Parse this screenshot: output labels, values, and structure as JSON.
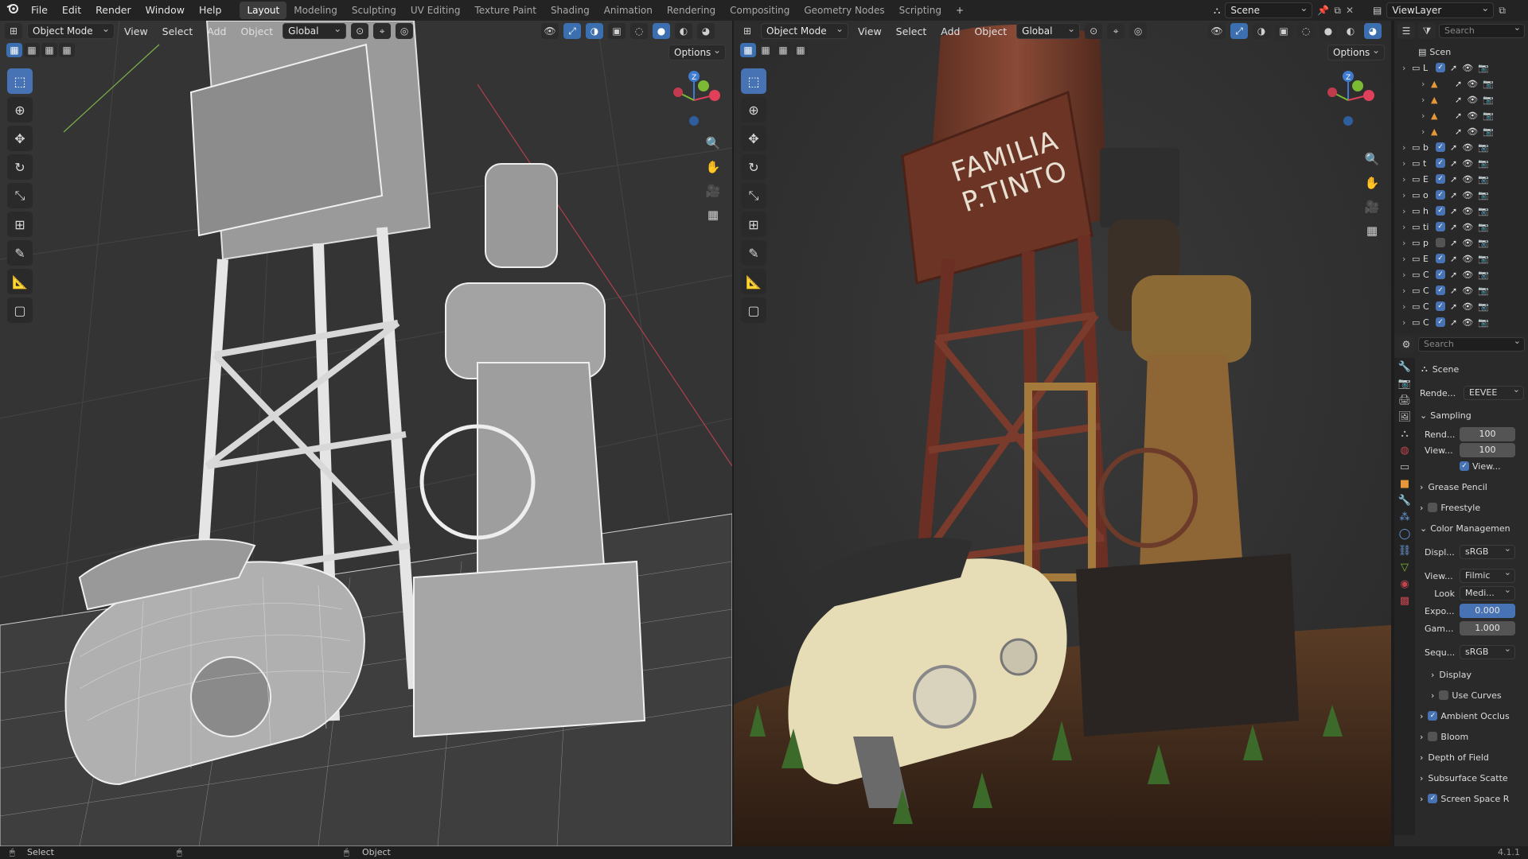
{
  "topbar": {
    "menus": [
      "File",
      "Edit",
      "Render",
      "Window",
      "Help"
    ],
    "workspaces": [
      "Layout",
      "Modeling",
      "Sculpting",
      "UV Editing",
      "Texture Paint",
      "Shading",
      "Animation",
      "Rendering",
      "Compositing",
      "Geometry Nodes",
      "Scripting"
    ],
    "active_workspace": "Layout",
    "plus": "+",
    "scene_name": "Scene",
    "viewlayer_name": "ViewLayer"
  },
  "left_viewport": {
    "mode": "Object Mode",
    "menus": [
      "View",
      "Select",
      "Add",
      "Object"
    ],
    "orientation": "Global",
    "options": "Options",
    "shading": "wireframe"
  },
  "right_viewport": {
    "mode": "Object Mode",
    "menus": [
      "View",
      "Select",
      "Add",
      "Object"
    ],
    "orientation": "Global",
    "options": "Options",
    "shading": "rendered",
    "sign_line1": "FAMILIA",
    "sign_line2": "P.TINTO"
  },
  "gizmo": {
    "x_color": "#e0405a",
    "y_color": "#7cba35",
    "z_color": "#3f7bd1",
    "z_label": "Z"
  },
  "outliner": {
    "search_placeholder": "Search",
    "scene_label": "Scen",
    "rows": [
      "L",
      "",
      "",
      "",
      "",
      "b",
      "t",
      "E",
      "o",
      "h",
      "ti",
      "p",
      "E",
      "C",
      "C",
      "C",
      "C"
    ]
  },
  "properties": {
    "search_placeholder": "Search",
    "scene_title": "Scene",
    "render_engine_label": "Rende...",
    "render_engine_value": "EEVEE",
    "sampling_label": "Sampling",
    "render_samples_label": "Rend...",
    "render_samples_value": "100",
    "viewport_samples_label": "View...",
    "viewport_samples_value": "100",
    "viewport_denoise_label": "View...",
    "grease_pencil": "Grease Pencil",
    "freestyle": "Freestyle",
    "color_management": "Color Managemen",
    "display_label": "Displ...",
    "display_value": "sRGB",
    "view_label": "View...",
    "view_value": "Filmic",
    "look_label": "Look",
    "look_value": "Medi...",
    "exposure_label": "Expo...",
    "exposure_value": "0.000",
    "gamma_label": "Gam...",
    "gamma_value": "1.000",
    "sequencer_label": "Sequ...",
    "sequencer_value": "sRGB",
    "display_sub": "Display",
    "use_curves": "Use Curves",
    "ambient_occlusion": "Ambient Occlus",
    "bloom": "Bloom",
    "depth_of_field": "Depth of Field",
    "subsurface": "Subsurface Scatte",
    "screen_space": "Screen Space R"
  },
  "status": {
    "select_label": "Select",
    "object_label": "Object",
    "version": "4.1.1"
  },
  "colors": {
    "accent": "#4772b3",
    "bg": "#303030",
    "header": "#232323"
  }
}
